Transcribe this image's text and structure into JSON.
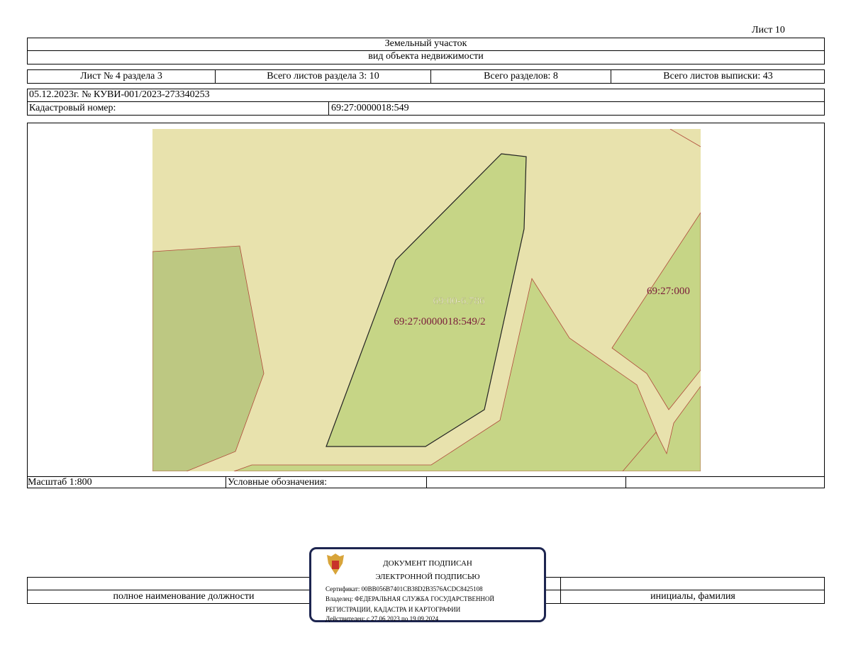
{
  "sheet_label": "Лист 10",
  "object_type": "Земельный участок",
  "object_type_caption": "вид объекта недвижимости",
  "header_row": [
    "Лист № 4 раздела 3",
    "Всего листов раздела 3: 10",
    "Всего разделов: 8",
    "Всего листов выписки: 43"
  ],
  "document_ref": "05.12.2023г. № КУВИ-001/2023-273340253",
  "cadastral_label": "Кадастровый номер:",
  "cadastral_number": "69:27:0000018:549",
  "map": {
    "labels": [
      "69:00-6.786",
      "69:27:0000018:549/2",
      "69:27:000"
    ],
    "colors": {
      "background": "#e8e2ad",
      "parcel": "#c6d586",
      "parcel_dark": "#bdc882",
      "border": "#b04a3a"
    }
  },
  "scale": "Масштаб 1:800",
  "legend_label": "Условные обозначения:",
  "footer": {
    "position": "полное наименование должности",
    "name": "инициалы, фамилия"
  },
  "stamp": {
    "line1": "ДОКУМЕНТ ПОДПИСАН",
    "line2": "ЭЛЕКТРОННОЙ ПОДПИСЬЮ",
    "certificate": "Сертификат: 00BB056B7401CB38D2B3576ACDC8425108",
    "owner1": "Владелец: ФЕДЕРАЛЬНАЯ СЛУЖБА ГОСУДАРСТВЕННОЙ",
    "owner2": "РЕГИСТРАЦИИ, КАДАСТРА И КАРТОГРАФИИ",
    "valid": "Действителен: с 27.06.2023 по 19.09.2024"
  }
}
